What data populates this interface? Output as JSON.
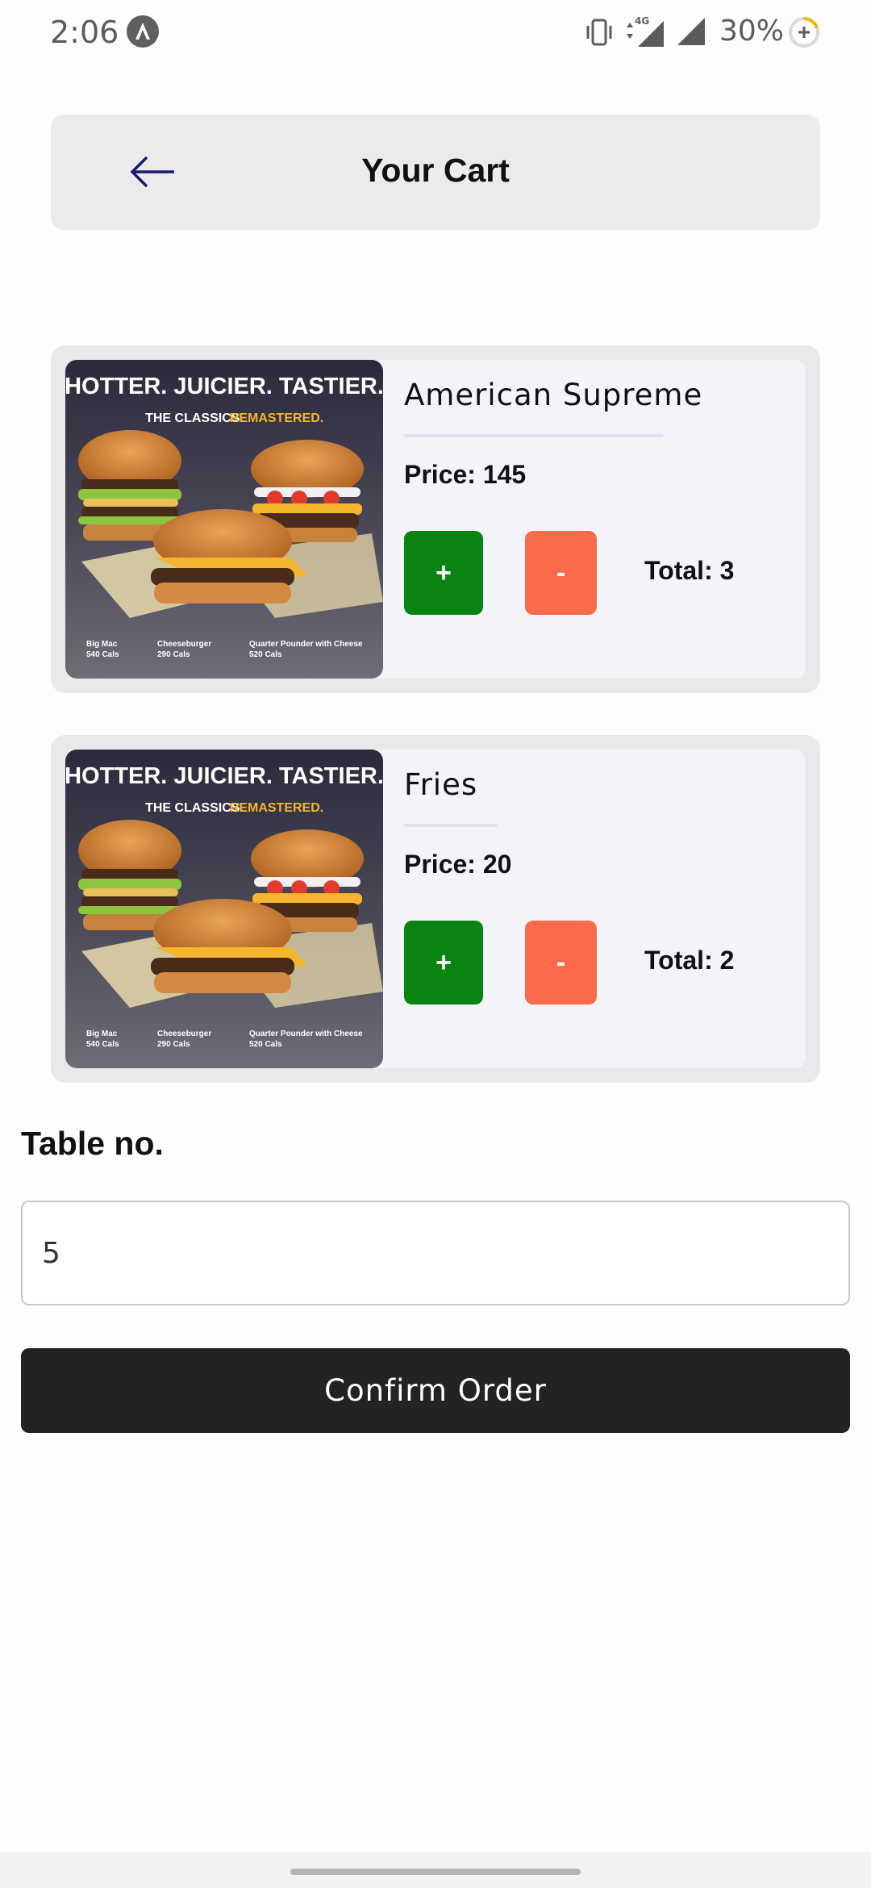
{
  "status_bar": {
    "time": "2:06",
    "network": "4G",
    "battery": "30%"
  },
  "header": {
    "title": "Your Cart"
  },
  "cart": {
    "items": [
      {
        "name": "American Supreme",
        "price_label": "Price: 145",
        "plus_label": "+",
        "minus_label": "-",
        "total_label": "Total: 3",
        "image": {
          "headline": "HOTTER. JUICIER. TASTIER.",
          "sub_white": "THE CLASSICS.",
          "sub_yellow": "REMASTERED.",
          "captions": [
            {
              "name": "Big Mac",
              "cals": "540 Cals"
            },
            {
              "name": "Cheeseburger",
              "cals": "290 Cals"
            },
            {
              "name": "Quarter Pounder with Cheese",
              "cals": "520 Cals"
            }
          ]
        }
      },
      {
        "name": "Fries",
        "price_label": "Price: 20",
        "plus_label": "+",
        "minus_label": "-",
        "total_label": "Total: 2",
        "image": {
          "headline": "HOTTER. JUICIER. TASTIER.",
          "sub_white": "THE CLASSICS.",
          "sub_yellow": "REMASTERED.",
          "captions": [
            {
              "name": "Big Mac",
              "cals": "540 Cals"
            },
            {
              "name": "Cheeseburger",
              "cals": "290 Cals"
            },
            {
              "name": "Quarter Pounder with Cheese",
              "cals": "520 Cals"
            }
          ]
        }
      }
    ]
  },
  "table": {
    "label": "Table no.",
    "value": "5"
  },
  "confirm": {
    "label": "Confirm Order"
  },
  "colors": {
    "plus": "#0a8410",
    "minus": "#fb6a4b",
    "confirm": "#232323",
    "header_bg": "#ebebeb",
    "back_arrow": "#1a1a6e"
  }
}
